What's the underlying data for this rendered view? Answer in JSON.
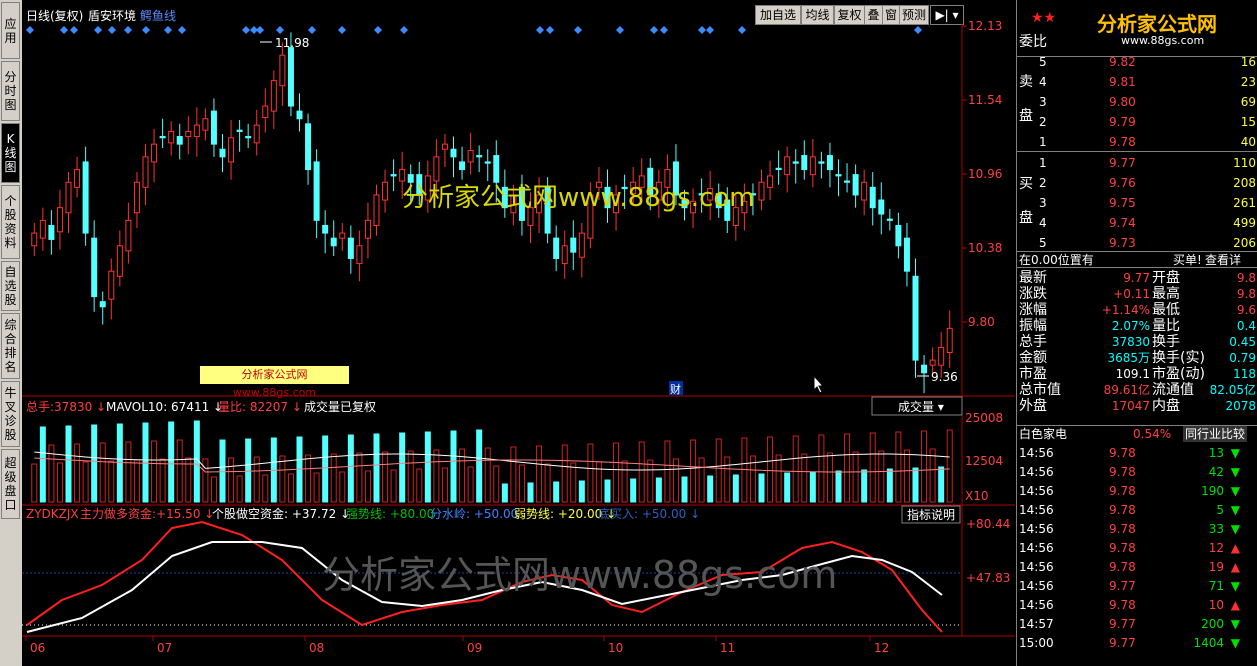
{
  "header": {
    "period_label": "日线(复权)",
    "stock_name": "盾安环境",
    "indicator_name": "鳄鱼线",
    "buttons": [
      "加自选",
      "均线",
      "复权",
      "叠",
      "窗",
      "预测"
    ]
  },
  "left_tabs": [
    "应用",
    "分时图",
    "K线图",
    "个股资料",
    "自选股",
    "综合排名",
    "牛叉诊股",
    "超级盘口"
  ],
  "price_axis": [
    "12.13",
    "11.54",
    "10.96",
    "10.38",
    "9.80"
  ],
  "annotations": {
    "high": "11.98",
    "low": "9.36",
    "finance_marker": "财"
  },
  "watermark": {
    "center_text": "分析家公式网www.88gs.com",
    "small_text": "分析家公式网www.88gs.com",
    "bottom_text": "分析家公式网www.88gs.com"
  },
  "volume_panel": {
    "total_label": "总手:",
    "total_value": "37830",
    "mavol_label": "MAVOL10:",
    "mavol_value": "67411",
    "ratio_label": "量比:",
    "ratio_value": "82207",
    "note": "成交量已复权",
    "dropdown": "成交量",
    "axis": [
      "25008",
      "12504",
      "X10"
    ]
  },
  "indicator_panel": {
    "name": "ZYDKZJX",
    "main_label": "主力做多资金:",
    "main_value": "+15.50",
    "retail_label": "个股做空资金:",
    "retail_value": "+37.72",
    "strong_label": "强势线:",
    "strong_value": "+80.00",
    "water_label": "分水岭:",
    "water_value": "+50.00",
    "weak_label": "弱势线:",
    "weak_value": "+20.00",
    "bottom_label": "底买入:",
    "bottom_value": "+50.00",
    "help_button": "指标说明",
    "axis": [
      "+80.44",
      "+47.83"
    ]
  },
  "x_axis": [
    "06",
    "07",
    "08",
    "09",
    "10",
    "11",
    "12"
  ],
  "order_book": {
    "header": "委比",
    "sell_label": "卖盘",
    "buy_label": "买盘",
    "sell": [
      {
        "level": "5",
        "price": "9.82",
        "vol": "16"
      },
      {
        "level": "4",
        "price": "9.81",
        "vol": "23"
      },
      {
        "level": "3",
        "price": "9.80",
        "vol": "69"
      },
      {
        "level": "2",
        "price": "9.79",
        "vol": "15"
      },
      {
        "level": "1",
        "price": "9.78",
        "vol": "40"
      }
    ],
    "buy": [
      {
        "level": "1",
        "price": "9.77",
        "vol": "110"
      },
      {
        "level": "2",
        "price": "9.76",
        "vol": "208"
      },
      {
        "level": "3",
        "price": "9.75",
        "vol": "261"
      },
      {
        "level": "4",
        "price": "9.74",
        "vol": "499"
      },
      {
        "level": "5",
        "price": "9.73",
        "vol": "206"
      }
    ]
  },
  "position_row": {
    "left": "在0.00位置有",
    "mid": "买单!",
    "right": "查看详"
  },
  "quote": [
    {
      "l": "最新",
      "lv": "9.77",
      "r": "开盘",
      "rv": "9.8"
    },
    {
      "l": "涨跌",
      "lv": "+0.11",
      "r": "最高",
      "rv": "9.8"
    },
    {
      "l": "涨幅",
      "lv": "+1.14%",
      "r": "最低",
      "rv": "9.6"
    },
    {
      "l": "振幅",
      "lv": "2.07%",
      "r": "量比",
      "rv": "0.4"
    },
    {
      "l": "总手",
      "lv": "37830",
      "r": "换手",
      "rv": "0.45"
    },
    {
      "l": "金额",
      "lv": "3685万",
      "r": "换手(实)",
      "rv": "0.79"
    },
    {
      "l": "市盈",
      "lv": "109.1",
      "r": "市盈(动)",
      "rv": "118"
    },
    {
      "l": "总市值",
      "lv": "89.61亿",
      "r": "流通值",
      "rv": "82.05亿"
    },
    {
      "l": "外盘",
      "lv": "17047",
      "r": "内盘",
      "rv": "2078"
    }
  ],
  "industry_row": {
    "name": "白色家电",
    "pct": "0.54%",
    "compare": "同行业比较"
  },
  "ticks": [
    {
      "time": "14:56",
      "price": "9.78",
      "vol": "13",
      "dir": "down"
    },
    {
      "time": "14:56",
      "price": "9.78",
      "vol": "42",
      "dir": "down"
    },
    {
      "time": "14:56",
      "price": "9.78",
      "vol": "190",
      "dir": "down"
    },
    {
      "time": "14:56",
      "price": "9.78",
      "vol": "5",
      "dir": "down"
    },
    {
      "time": "14:56",
      "price": "9.78",
      "vol": "33",
      "dir": "down"
    },
    {
      "time": "14:56",
      "price": "9.78",
      "vol": "12",
      "dir": "up"
    },
    {
      "time": "14:56",
      "price": "9.78",
      "vol": "19",
      "dir": "up"
    },
    {
      "time": "14:56",
      "price": "9.77",
      "vol": "71",
      "dir": "down"
    },
    {
      "time": "14:56",
      "price": "9.78",
      "vol": "10",
      "dir": "up"
    },
    {
      "time": "14:57",
      "price": "9.77",
      "vol": "200",
      "dir": "down"
    },
    {
      "time": "15:00",
      "price": "9.77",
      "vol": "1404",
      "dir": "down"
    }
  ],
  "colors": {
    "up": "#ff3232",
    "down": "#54ffff",
    "axis": "#b00000",
    "text_red": "#ff4040",
    "bg": "#000000"
  },
  "logo_text": "分析家公式网",
  "logo_url": "www.88gs.com"
}
